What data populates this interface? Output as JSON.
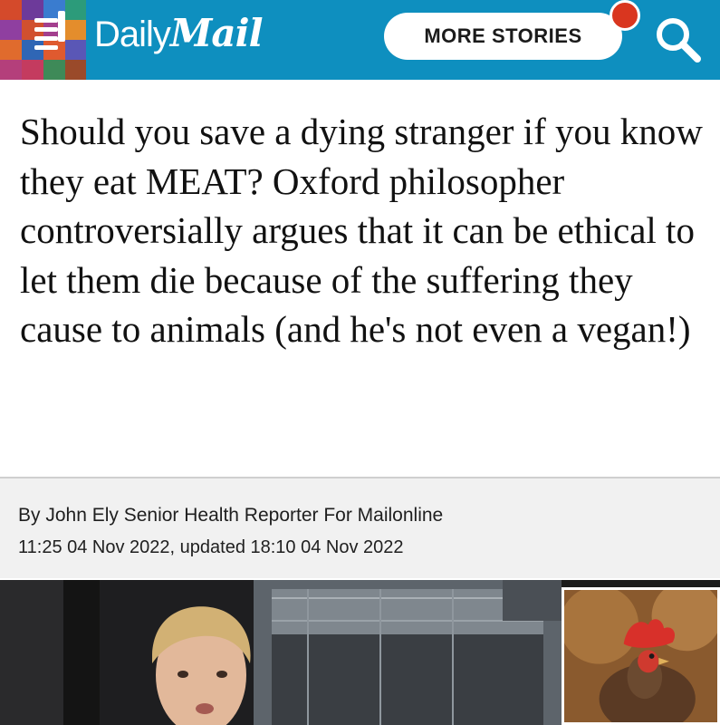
{
  "header": {
    "brand_daily": "Daily",
    "brand_mail": "Mail",
    "more_stories_label": "MORE STORIES",
    "menu_icon": "hamburger-menu-icon",
    "search_icon": "search-icon",
    "notification_icon": "notification-dot-icon",
    "header_color": "#0e8fbf",
    "notification_color": "#d9361f"
  },
  "article": {
    "headline": "Should you save a dying stranger if you know they eat MEAT? Oxford philosopher controversially argues that it can be ethical to let them die because of the suffering they cause to animals (and he's not even a vegan!)",
    "byline": "By John Ely Senior Health Reporter For Mailonline",
    "dateline": "11:25 04 Nov 2022, updated 18:10 04 Nov 2022"
  },
  "images": {
    "main_photo": "man-speaking-photo",
    "inset_photo": "chicken-photo"
  }
}
